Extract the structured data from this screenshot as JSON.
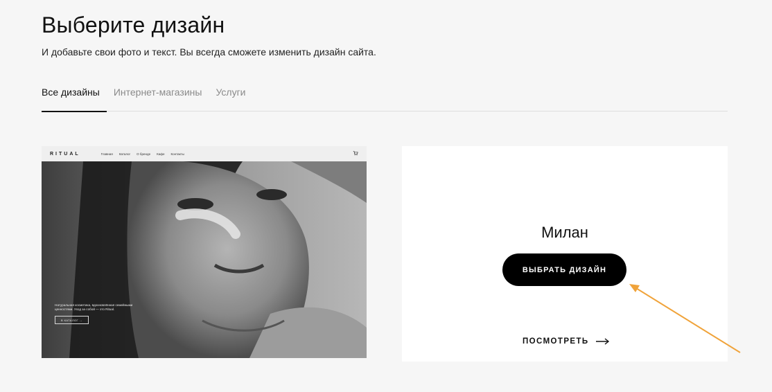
{
  "header": {
    "title": "Выберите дизайн",
    "subtitle": "И добавьте свои фото и текст. Вы всегда сможете изменить дизайн сайта."
  },
  "tabs": [
    {
      "label": "Все дизайны",
      "active": true
    },
    {
      "label": "Интернет-магазины",
      "active": false
    },
    {
      "label": "Услуги",
      "active": false
    }
  ],
  "preview": {
    "logo": "RITUAL",
    "nav": [
      "Главная",
      "Каталог",
      "О бренде",
      "Кафе",
      "Контакты"
    ],
    "caption": "Натуральная косметика, вдохновлённая семейными ценностями. Уход за собой — это Ritual.",
    "cta": "В КАТАЛОГ →",
    "cart_icon": "cart-icon"
  },
  "design_card": {
    "name": "Милан",
    "select_label": "ВЫБРАТЬ ДИЗАЙН",
    "view_label": "ПОСМОТРЕТЬ",
    "view_icon": "arrow-right-icon"
  },
  "annotation": {
    "color": "#f0a33a"
  }
}
